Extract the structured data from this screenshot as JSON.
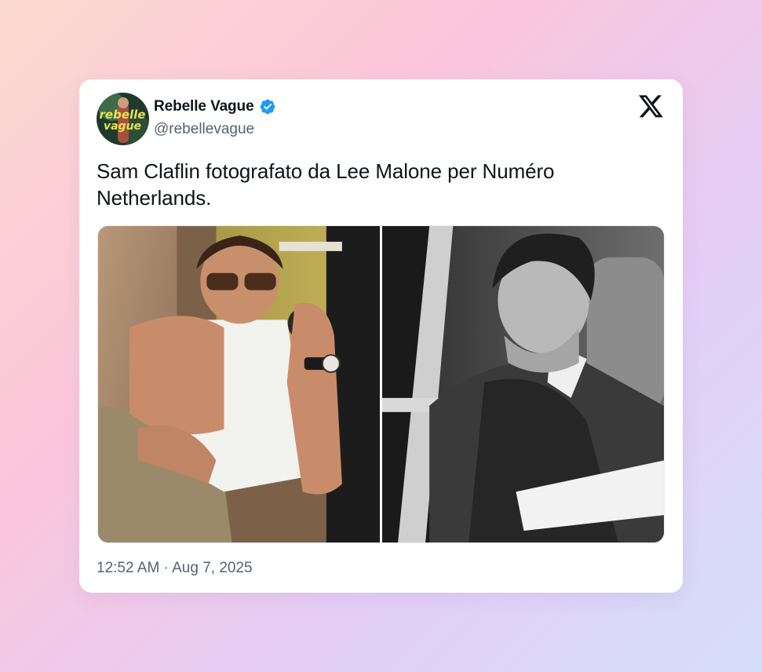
{
  "author": {
    "display_name": "Rebelle Vague",
    "handle": "@rebellevague",
    "verified": true,
    "avatar_text": "rebelle vague",
    "verified_color": "#1d9bf0"
  },
  "post": {
    "text": "Sam Claflin fotografato da Lee Malone per Numéro Netherlands.",
    "timestamp": "12:52 AM · Aug 7, 2025"
  },
  "media": [
    {
      "description": "man in white tank top and sunglasses reclining in a car",
      "style": "color"
    },
    {
      "description": "man in velvet jacket leaning out of a car window",
      "style": "black-and-white"
    }
  ],
  "icons": {
    "platform": "x-logo-icon",
    "verified": "verified-badge-icon"
  }
}
